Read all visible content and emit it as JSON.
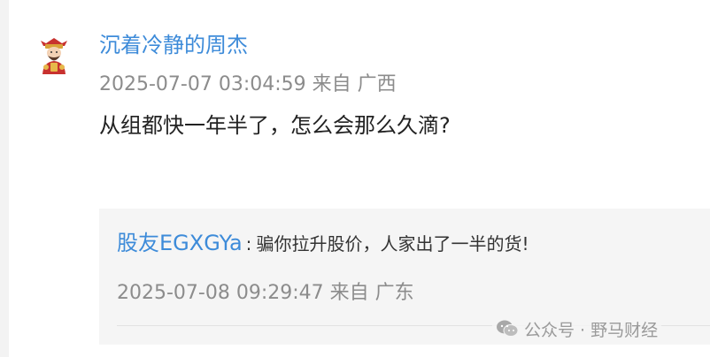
{
  "comment": {
    "username": "沉着冷静的周杰",
    "meta": "2025-07-07 03:04:59 来自 广西",
    "text": "从组都快一年半了，怎么会那么久滴?"
  },
  "reply": {
    "username": "股友EGXGYa",
    "separator": ":",
    "text": "骗你拉升股价，人家出了一半的货!",
    "meta": "2025-07-08 09:29:47   来自 广东"
  },
  "watermark": {
    "text": "公众号 · 野马财经",
    "icon": "wechat-icon"
  },
  "colors": {
    "link_blue": "#3d8bd9",
    "meta_gray": "#8c8c8c",
    "reply_bg": "#f5f5f5"
  }
}
